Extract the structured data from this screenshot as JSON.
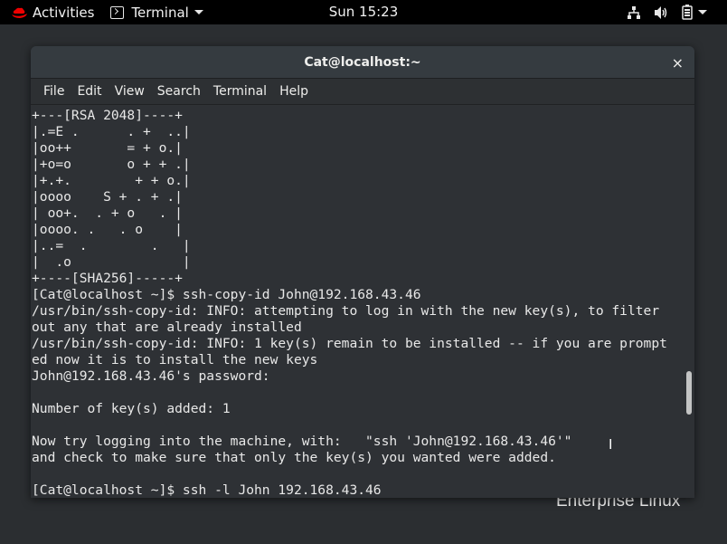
{
  "topbar": {
    "activities": "Activities",
    "app_menu": "Terminal",
    "clock": "Sun 15:23",
    "tray_icons": [
      "network-icon",
      "volume-icon",
      "battery-icon",
      "chevron-down-icon"
    ]
  },
  "window": {
    "title": "Cat@localhost:~",
    "close": "×",
    "menu": [
      "File",
      "Edit",
      "View",
      "Search",
      "Terminal",
      "Help"
    ]
  },
  "terminal": {
    "lines": [
      "+---[RSA 2048]----+",
      "|.=E .      . +  ..|",
      "|oo++       = + o.|",
      "|+o=o       o + + .|",
      "|+.+.        + + o.|",
      "|oooo    S + . + .|",
      "| oo+.  . + o   . |",
      "|oooo. .   . o    |",
      "|..=  .        .   |",
      "|  .o              |",
      "+----[SHA256]-----+",
      "[Cat@localhost ~]$ ssh-copy-id John@192.168.43.46",
      "/usr/bin/ssh-copy-id: INFO: attempting to log in with the new key(s), to filter",
      "out any that are already installed",
      "/usr/bin/ssh-copy-id: INFO: 1 key(s) remain to be installed -- if you are prompt",
      "ed now it is to install the new keys",
      "John@192.168.43.46's password:",
      "",
      "Number of key(s) added: 1",
      "",
      "Now try logging into the machine, with:   \"ssh 'John@192.168.43.46'\"",
      "and check to make sure that only the key(s) you wanted were added.",
      "",
      "[Cat@localhost ~]$ ssh -l John 192.168.43.46"
    ]
  },
  "desktop": {
    "watermark": "Enterprise Linux"
  },
  "colors": {
    "topbar": "#000000",
    "desktop": "#2b2e31",
    "terminal_bg": "#2e3135",
    "terminal_fg": "#e8e8e8",
    "redhat_red": "#ee0000"
  }
}
